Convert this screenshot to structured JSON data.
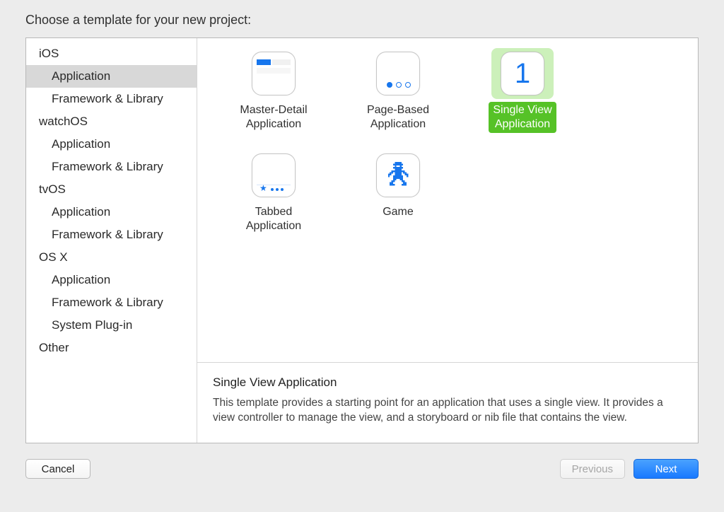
{
  "prompt": "Choose a template for your new project:",
  "sidebar": {
    "platforms": [
      {
        "name": "iOS",
        "items": [
          "Application",
          "Framework & Library"
        ]
      },
      {
        "name": "watchOS",
        "items": [
          "Application",
          "Framework & Library"
        ]
      },
      {
        "name": "tvOS",
        "items": [
          "Application",
          "Framework & Library"
        ]
      },
      {
        "name": "OS X",
        "items": [
          "Application",
          "Framework & Library",
          "System Plug-in"
        ]
      },
      {
        "name": "Other",
        "items": []
      }
    ],
    "selected": {
      "platform": "iOS",
      "item": "Application"
    }
  },
  "templates": [
    {
      "id": "master-detail",
      "label": "Master-Detail\nApplication",
      "selected": false
    },
    {
      "id": "page-based",
      "label": "Page-Based\nApplication",
      "selected": false
    },
    {
      "id": "single-view",
      "label": "Single View\nApplication",
      "selected": true
    },
    {
      "id": "tabbed",
      "label": "Tabbed\nApplication",
      "selected": false
    },
    {
      "id": "game",
      "label": "Game",
      "selected": false
    }
  ],
  "description": {
    "title": "Single View Application",
    "body": "This template provides a starting point for an application that uses a single view. It provides a view controller to manage the view, and a storyboard or nib file that contains the view."
  },
  "buttons": {
    "cancel": "Cancel",
    "previous": "Previous",
    "next": "Next",
    "previous_enabled": false
  }
}
